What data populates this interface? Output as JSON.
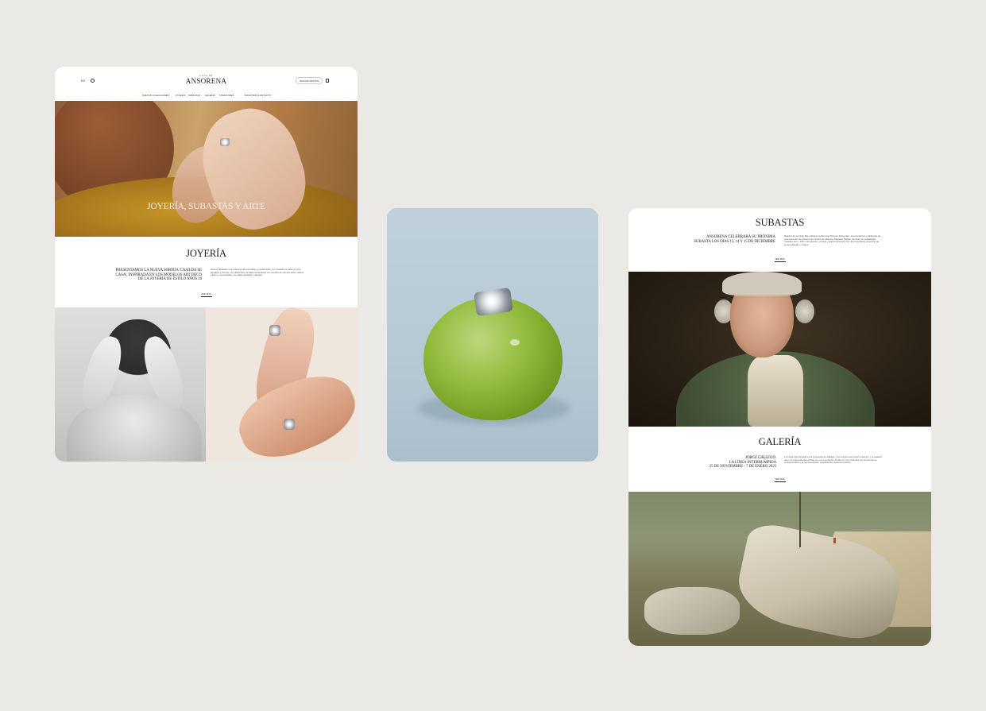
{
  "jewelry_page": {
    "header": {
      "lang": "ES",
      "logo_small": "CASA DE",
      "logo": "ANSORENA",
      "auth_button": "INICIAR SESIÓN",
      "nav": [
        "NUEVAS COLECCIONES",
        "JOYERÍA",
        "SUBASTAS",
        "GALERÍA",
        "TASACIONES",
        "NOSOTROS",
        "CONTACTO"
      ]
    },
    "hero_title": "JOYERÍA, SUBASTAS Y ARTE",
    "section": {
      "title": "JOYERÍA",
      "lead": "PRESENTAMOS LA NUEVA SORTIJA 'CASILDA SE CASA', INSPIRADA EN LOS MODELOS ART DECO DE LA JOYERÍA DE ESTILO AÑOS 20",
      "body": "Hemos diseñado una nueva sortija pensada en celebración con 'Casilda se casa' en tres tamaños y formas, con diamantes de talla combinados con piedras de colores sobre relieve, zafiros y esmeraldas y de tallas variadas y alegras.",
      "more": "VER MÁS"
    }
  },
  "right_page": {
    "subastas": {
      "title": "SUBASTAS",
      "lead": "ANSORENA CELEBRARÁ SU PRÓXIMA SUBASTA LOS DÍAS 13, 14 Y 15 DE DICIEMBRE",
      "body": "Retrato de Gonzalo Baro Albéniz cedido tras Romero Fitzgerald, Jose Gutiérrez y Alcántara de una colección de obras entre pintura de Mariano Salvador Maella. También se subastarán muebles del s. XVIII, porcelanas y relojes y platos para este con una importante colección de joyas antiguas y relojes.",
      "more": "VER MÁS"
    },
    "galeria": {
      "title": "GALERÍA",
      "lead_artist": "JORGE GALLEGO.",
      "lead_line2": "LA LÍNEA INTERRUMPIDA",
      "lead_dates": "25 DE NOVIEMBRE - 7 DE ENERO 2023",
      "body": "La Línea Interrumpida es la propuesta de Gallego y su universo temporal, el tiempo y el espacio que nos presenta este artista con una exposición donde es muy dinámica con la técnica de pintura acrílica y la representación simbólica de nuestros pueblos.",
      "more": "VER MÁS"
    }
  }
}
